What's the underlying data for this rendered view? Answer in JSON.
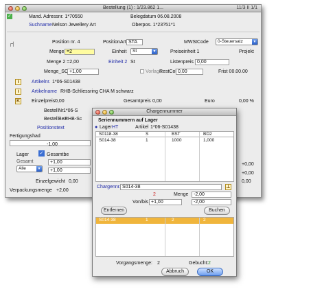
{
  "main_window": {
    "title": "Bestellung (1) : 1/23.862 1...",
    "number": "11/3 II 1/1",
    "info": {
      "mand_label": "Mand. Adressnr. 1*70550",
      "belegdatum_label": "Belegdatum 06.08.2008",
      "suchname_label": "Suchname",
      "suchname_value": "Nelson Jewellery Art",
      "oberpos_label": "Oberpos. 1*23?51*1"
    },
    "row1": {
      "position_label": "Position nr. 4",
      "positionsart_label": "PositionArt",
      "positionsart_value": "STA",
      "mwst_label": "MWStCode",
      "mwst_value": "0-Steuersatz"
    },
    "row2": {
      "menge_label": "Menge",
      "menge_value": "=2",
      "einheit_label": "Einheit",
      "einheit_value": "St",
      "preiseinheit_label": "Preiseinheit 1",
      "projekt_label": "Projekt"
    },
    "row3": {
      "menge2_label": "Menge 2 =2,00",
      "einheit2_label": "Einheit 2",
      "einheit2_value": "St",
      "listenpreis_label": "Listenpreis",
      "listenpreis_value": "0,00"
    },
    "row4": {
      "menge_so_label": "Menge_SO",
      "menge_so_value": "+1,00",
      "vorlage_label": "Vorlage",
      "restcol_label": "RestColl",
      "restcol_value": "0,00",
      "frist_label": "Frist 00.00.00"
    },
    "artikel": {
      "artikelnr_label": "Artikelnr.",
      "artikelnr_value": "1*06-S01438",
      "artikelname_label": "Artikelname",
      "artikelname_value": "RHB-Schliessring CHA M schwarz",
      "einzelpreis_label": "Einzelpreis",
      "einzelpreis_value": "0,00",
      "gesamtpreis_label": "Gesamtpreis",
      "gesamtpreis_value": "0,00",
      "euro_label": "Euro",
      "euro_value": "0,00 %"
    },
    "left_rows": {
      "bestellnr_label": "BestellNr",
      "bestellnr_value": "1*06-S",
      "bestellbez_label": "BestellBez",
      "bestellbez_value": "RHB-Sc",
      "positionstext_label": "Positionstext",
      "fertigungshad_label": "Fertigungshad",
      "value_neg": "-1,00",
      "lager_label": "Lager",
      "gesamtbe_label": "Gesamtbe",
      "gesamt_label": "Gesamt",
      "lager_select": "Alle",
      "val_a": "+1,00",
      "val_b": "+1,00",
      "einzelgewicht_label": "Einzelgewicht",
      "einzelgewicht_value": "0,00",
      "verpackung_label": "Verpackungsmenge",
      "verpackung_value": "+2,00",
      "right_val_1": "+0,00",
      "right_val_2": "+0,00",
      "right_val_3": "0,00"
    }
  },
  "dialog": {
    "title": "Chargennummer",
    "section_title": "Seriennummern auf Lager",
    "lager_label": "Lager",
    "lager_value": "HT",
    "artikel_label": "Artikel",
    "artikel_value": "1*06-S01438",
    "table_headers": [
      "S0118-38",
      "S",
      "BST",
      "BD2"
    ],
    "table_rows": [
      [
        "S014-38",
        "1",
        "1000",
        "1,000"
      ]
    ],
    "charge_label": "Chargennr.",
    "charge_value": "S014-38",
    "menge_label": "Menge",
    "menge_value": "-2,00",
    "red_number": "2",
    "von_bis_label": "Von/bis",
    "von_value": "+1,00",
    "bis_value": "-2,00",
    "entfernen_label": "Entfernen",
    "buchen_label": "Buchen",
    "selected_row": [
      "S014-38",
      "1",
      "2",
      "2"
    ],
    "vorgangsmenge_label": "Vorgangsmenge:",
    "vorgangsmenge_value": "2",
    "gebucht_label": "Gebucht:",
    "gebucht_value": "2",
    "abbruch_label": "Abbruch",
    "ok_label": "OK"
  },
  "colors": {
    "accent_blue": "#1f2aa8",
    "selection": "#f0b53c",
    "yellow_field": "#fffca0",
    "red_text": "#cc2222"
  }
}
